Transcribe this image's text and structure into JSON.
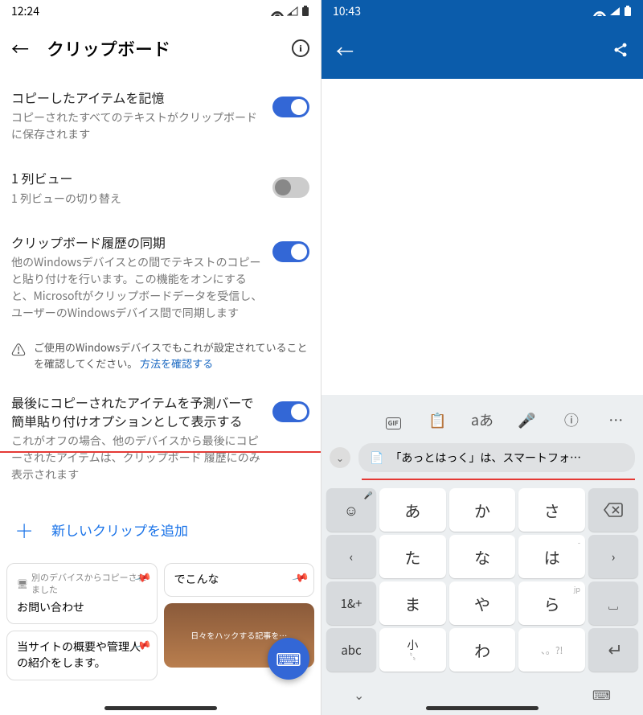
{
  "left": {
    "status_time": "12:24",
    "header": {
      "title": "クリップボード"
    },
    "settings": [
      {
        "title": "コピーしたアイテムを記憶",
        "sub": "コピーされたすべてのテキストがクリップボードに保存されます",
        "on": true
      },
      {
        "title": "1 列ビュー",
        "sub": "1 列ビューの切り替え",
        "on": false
      },
      {
        "title": "クリップボード履歴の同期",
        "sub": "他のWindowsデバイスとの間でテキストのコピーと貼り付けを行います。この機能をオンにすると、Microsoftがクリップボードデータを受信し、ユーザーのWindowsデバイス間で同期します",
        "on": true
      },
      {
        "title": "最後にコピーされたアイテムを予測バーで簡単貼り付けオプションとして表示する",
        "sub": "これがオフの場合、他のデバイスから最後にコピーされたアイテムは、クリップボード 履歴にのみ表示されます",
        "on": true
      }
    ],
    "warn_text": "ご使用のWindowsデバイスでもこれが設定されていることを確認してください。",
    "warn_link": "方法を確認する",
    "add_clip": "新しいクリップを追加",
    "clips": {
      "c1_cap": "別のデバイスからコピーされました",
      "c1_text": "お問い合わせ",
      "c2_text": "でこんな",
      "c3_text": "当サイトの概要や管理人の紹介をします。",
      "c4_caption": "日々をハックする記事を…"
    }
  },
  "right": {
    "status_time": "10:43",
    "suggestion": "「あっとはっく」は、スマートフォ…",
    "toolbar": {
      "gif": "GIF",
      "lang": "aあ"
    },
    "keys": {
      "r1": [
        "",
        "あ",
        "か",
        "さ",
        ""
      ],
      "r2": [
        "",
        "た",
        "な",
        "は",
        ""
      ],
      "r3": [
        "1&+",
        "ま",
        "や",
        "ら",
        ""
      ],
      "r4": [
        "abc",
        "",
        "わ",
        "",
        ""
      ],
      "sup": {
        "ha": "-",
        "ra": "jp"
      },
      "small_top": "小",
      "small_bot": "〝〟",
      "punct": "、。?!"
    }
  }
}
